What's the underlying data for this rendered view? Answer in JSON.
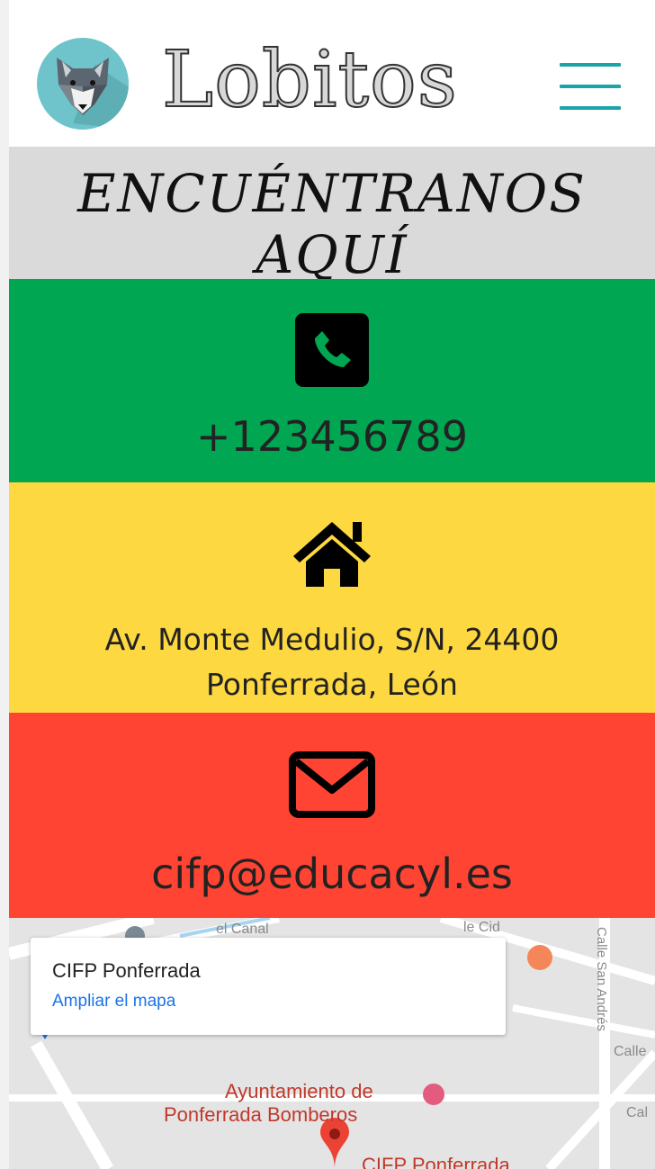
{
  "header": {
    "brand": "Lobitos",
    "logo_icon": "wolf-icon",
    "menu_icon": "hamburger-icon"
  },
  "heading": "ENCUÉNTRANOS AQUÍ",
  "contact": {
    "phone": "+123456789",
    "address_line1": "Av. Monte Medulio, S/N, 24400",
    "address_line2": "Ponferrada, León",
    "email": "cifp@educacyl.es"
  },
  "colors": {
    "phone_bg": "#00a651",
    "address_bg": "#fdd841",
    "email_bg": "#ff4433",
    "heading_bg": "#dadada",
    "accent": "#1aa4a8"
  },
  "map": {
    "place_name": "CIFP Ponferrada",
    "enlarge_link": "Ampliar el mapa",
    "poi_line1": "Ayuntamiento de",
    "poi_line2": "Ponferrada Bomberos",
    "marker_label": "CIFP Ponferrada",
    "street_cid": "le Cid",
    "street_canal": "el Canal",
    "street_san_andres": "Calle San Andrés",
    "street_calle1": "Calle",
    "street_calle2": "Cal"
  }
}
